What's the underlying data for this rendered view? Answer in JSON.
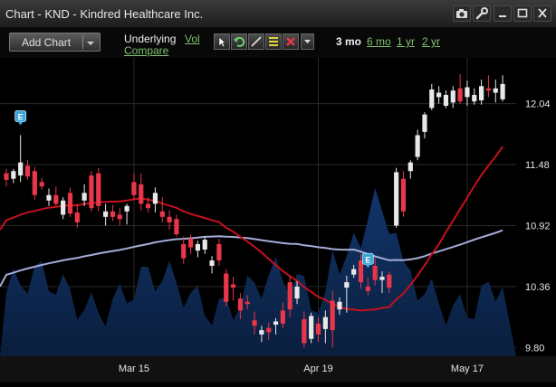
{
  "window": {
    "title": "Chart - KND - Kindred Healthcare Inc."
  },
  "toolbar": {
    "add_chart_label": "Add Chart",
    "underlying_label": "Underlying",
    "vol_link": "Vol",
    "compare_link": "Compare",
    "range_active": "3 mo",
    "range_links": [
      "6 mo",
      "1 yr",
      "2 yr"
    ]
  },
  "icons": [
    "camera-icon",
    "wrench-icon",
    "minimize-icon",
    "maximize-icon",
    "close-icon",
    "cursor-icon",
    "undo-icon",
    "line-draw-icon",
    "text-lines-icon",
    "delete-icon",
    "dropdown-arrow-icon"
  ],
  "colors": {
    "up_candle": "#e8e8e8",
    "down_candle": "#e8364a",
    "ma_short": "#c4111e",
    "ma_long": "#a5acd8",
    "volume_area": "#0d2a55",
    "link": "#7fc36e"
  },
  "chart_data": {
    "type": "candlestick",
    "symbol": "KND",
    "y_ticks": [
      "12.04",
      "11.48",
      "10.92",
      "10.36",
      "9.80"
    ],
    "ylim": [
      9.72,
      12.46
    ],
    "x_ticks": [
      {
        "label": "Mar 15",
        "index": 18
      },
      {
        "label": "Apr 19",
        "index": 44
      },
      {
        "label": "May 17",
        "index": 65
      }
    ],
    "earnings_markers": [
      {
        "label": "E",
        "index": 2
      },
      {
        "label": "E",
        "index": 51
      }
    ],
    "ohlc": [
      [
        11.4,
        11.44,
        11.28,
        11.34
      ],
      [
        11.35,
        11.44,
        11.31,
        11.42
      ],
      [
        11.38,
        11.75,
        11.32,
        11.5
      ],
      [
        11.47,
        11.52,
        11.34,
        11.37
      ],
      [
        11.42,
        11.46,
        11.16,
        11.2
      ],
      [
        11.32,
        11.36,
        11.25,
        11.28
      ],
      [
        11.15,
        11.26,
        11.1,
        11.2
      ],
      [
        11.2,
        11.28,
        11.1,
        11.12
      ],
      [
        11.02,
        11.18,
        10.98,
        11.15
      ],
      [
        11.22,
        11.27,
        11.0,
        11.03
      ],
      [
        11.04,
        11.12,
        10.9,
        10.95
      ],
      [
        11.15,
        11.3,
        11.1,
        11.22
      ],
      [
        11.38,
        11.42,
        11.05,
        11.08
      ],
      [
        11.4,
        11.45,
        11.05,
        11.1
      ],
      [
        11.0,
        11.12,
        10.92,
        11.05
      ],
      [
        11.05,
        11.11,
        10.96,
        11.0
      ],
      [
        11.02,
        11.08,
        10.92,
        10.98
      ],
      [
        11.05,
        11.12,
        10.93,
        11.1
      ],
      [
        11.32,
        11.4,
        11.15,
        11.2
      ],
      [
        11.3,
        11.4,
        11.06,
        11.12
      ],
      [
        11.12,
        11.18,
        11.04,
        11.08
      ],
      [
        11.12,
        11.27,
        11.04,
        11.22
      ],
      [
        11.05,
        11.18,
        10.95,
        11.0
      ],
      [
        11.0,
        11.06,
        10.88,
        10.95
      ],
      [
        10.98,
        11.02,
        10.82,
        10.84
      ],
      [
        10.75,
        10.82,
        10.57,
        10.62
      ],
      [
        10.8,
        10.84,
        10.66,
        10.72
      ],
      [
        10.69,
        10.78,
        10.63,
        10.75
      ],
      [
        10.7,
        10.82,
        10.66,
        10.79
      ],
      [
        10.55,
        10.64,
        10.48,
        10.6
      ],
      [
        10.75,
        10.8,
        10.55,
        10.6
      ],
      [
        10.48,
        10.52,
        10.18,
        10.22
      ],
      [
        10.38,
        10.45,
        10.23,
        10.35
      ],
      [
        10.25,
        10.3,
        10.06,
        10.14
      ],
      [
        10.22,
        10.28,
        10.15,
        10.2
      ],
      [
        10.05,
        10.13,
        9.92,
        10.0
      ],
      [
        9.92,
        10.0,
        9.85,
        9.96
      ],
      [
        9.98,
        10.03,
        9.87,
        9.94
      ],
      [
        10.01,
        10.07,
        9.92,
        10.04
      ],
      [
        10.14,
        10.21,
        9.98,
        10.02
      ],
      [
        10.4,
        10.46,
        10.08,
        10.15
      ],
      [
        10.25,
        10.41,
        10.2,
        10.36
      ],
      [
        10.06,
        10.13,
        9.8,
        9.84
      ],
      [
        9.88,
        10.12,
        9.84,
        10.09
      ],
      [
        10.02,
        10.08,
        9.85,
        9.92
      ],
      [
        9.97,
        10.14,
        9.84,
        10.08
      ],
      [
        10.23,
        10.32,
        9.8,
        9.96
      ],
      [
        10.15,
        10.26,
        10.1,
        10.22
      ],
      [
        10.35,
        10.46,
        10.12,
        10.4
      ],
      [
        10.47,
        10.56,
        10.44,
        10.52
      ],
      [
        10.6,
        10.66,
        10.34,
        10.4
      ],
      [
        10.36,
        10.44,
        10.28,
        10.32
      ],
      [
        10.55,
        10.62,
        10.37,
        10.42
      ],
      [
        10.42,
        10.5,
        10.3,
        10.45
      ],
      [
        10.47,
        10.5,
        10.3,
        10.35
      ],
      [
        10.92,
        11.45,
        10.9,
        11.41
      ],
      [
        11.35,
        11.42,
        11.0,
        11.05
      ],
      [
        11.42,
        11.52,
        11.35,
        11.5
      ],
      [
        11.55,
        11.8,
        11.52,
        11.75
      ],
      [
        11.78,
        11.96,
        11.72,
        11.94
      ],
      [
        12.0,
        12.22,
        11.98,
        12.17
      ],
      [
        12.1,
        12.2,
        12.04,
        12.14
      ],
      [
        12.02,
        12.16,
        12.0,
        12.12
      ],
      [
        12.05,
        12.2,
        12.0,
        12.16
      ],
      [
        12.18,
        12.31,
        12.04,
        12.06
      ],
      [
        12.1,
        12.25,
        12.02,
        12.19
      ],
      [
        12.06,
        12.18,
        12.03,
        12.12
      ],
      [
        12.07,
        12.26,
        12.03,
        12.2
      ],
      [
        12.18,
        12.3,
        12.1,
        12.16
      ],
      [
        12.14,
        12.26,
        12.05,
        12.18
      ],
      [
        12.08,
        12.3,
        12.06,
        12.22
      ]
    ]
  }
}
